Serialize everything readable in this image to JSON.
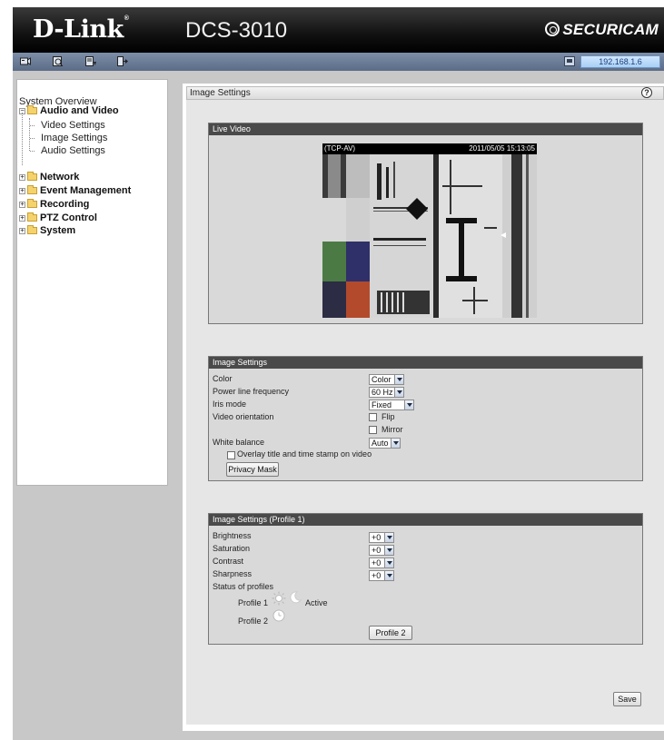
{
  "header": {
    "brand": "D-Link",
    "model": "DCS-3010",
    "securicam": "SECURICAM"
  },
  "toolbar": {
    "icons": [
      "live-video-icon",
      "setup-icon",
      "config-icon",
      "logout-icon"
    ],
    "ip_address": "192.168.1.6"
  },
  "sidebar": {
    "overview": "System Overview",
    "audio_video": "Audio and Video",
    "sub_items": [
      "Video Settings",
      "Image Settings",
      "Audio Settings"
    ],
    "groups": [
      "Network",
      "Event Management",
      "Recording",
      "PTZ Control",
      "System"
    ]
  },
  "page": {
    "title": "Image Settings",
    "help": "?"
  },
  "live_video": {
    "title": "Live Video",
    "protocol": "(TCP-AV)",
    "timestamp": "2011/05/05 15:13:05"
  },
  "image_settings": {
    "title": "Image Settings",
    "color_label": "Color",
    "color_value": "Color",
    "power_label": "Power line frequency",
    "power_value": "60 Hz",
    "iris_label": "Iris mode",
    "iris_value": "Fixed",
    "orientation_label": "Video orientation",
    "flip_label": "Flip",
    "mirror_label": "Mirror",
    "wb_label": "White balance",
    "wb_value": "Auto",
    "overlay_label": "Overlay title and time stamp on video",
    "privacy_button": "Privacy Mask"
  },
  "profile_settings": {
    "title": "Image Settings (Profile 1)",
    "brightness_label": "Brightness",
    "brightness_value": "+0",
    "saturation_label": "Saturation",
    "saturation_value": "+0",
    "contrast_label": "Contrast",
    "contrast_value": "+0",
    "sharpness_label": "Sharpness",
    "sharpness_value": "+0",
    "status_label": "Status of profiles",
    "profile1_label": "Profile 1",
    "profile1_status": "Active",
    "profile2_label": "Profile 2",
    "profile2_button": "Profile 2"
  },
  "save_button": "Save",
  "colors": {
    "header_bg": "#000000",
    "toolbar_bg": "#6a7b96",
    "section_title_bg": "#4a4a4a",
    "panel_bg": "#d9d9d9",
    "frame_bg": "#c8c8c8"
  }
}
